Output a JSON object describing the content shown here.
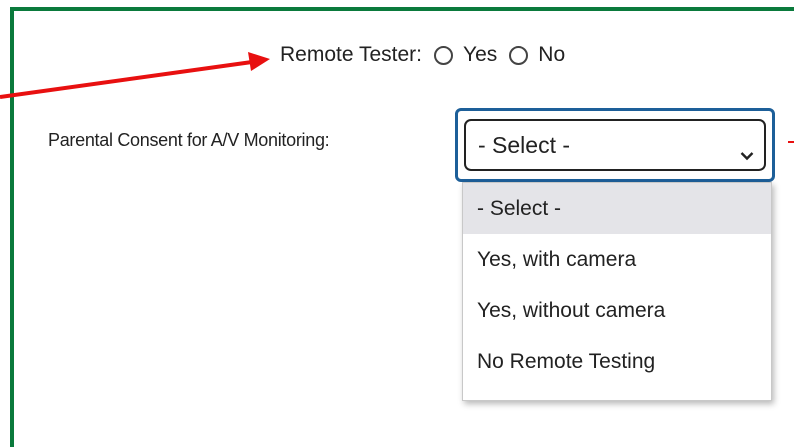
{
  "remote_tester": {
    "label": "Remote Tester:",
    "options": [
      "Yes",
      "No"
    ]
  },
  "parental_consent": {
    "label": "Parental Consent for A/V Monitoring:",
    "selected": "- Select -",
    "options": [
      "- Select -",
      "Yes, with camera",
      "Yes, without camera",
      "No Remote Testing"
    ]
  },
  "colors": {
    "frame": "#0a7a3c",
    "focus_ring": "#1d5f99",
    "annotation_arrow": "#e81010",
    "highlighted_option": "#e4e4e8"
  }
}
